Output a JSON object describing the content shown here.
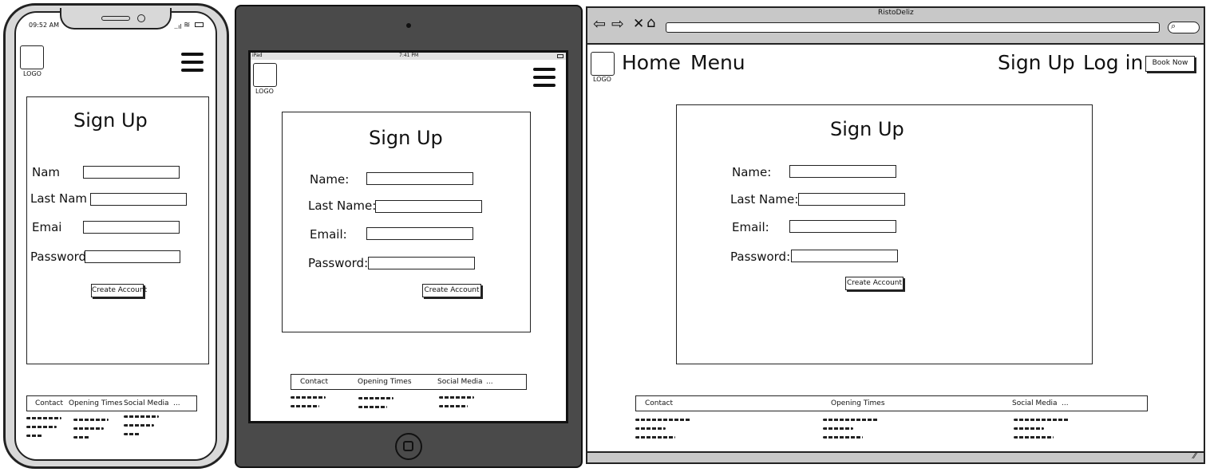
{
  "mobile": {
    "status_time": "09:52 AM",
    "logo_label": "LOGO",
    "title": "Sign Up",
    "labels": [
      "Nam",
      "Last Nam",
      "Emai",
      "Password"
    ],
    "button": "Create Account",
    "footer": [
      "Contact",
      "Opening Times",
      "Social Media",
      "..."
    ]
  },
  "tablet": {
    "status_device": "iPad",
    "status_time": "7:41 PM",
    "logo_label": "LOGO",
    "title": "Sign Up",
    "labels": [
      "Name:",
      "Last Name:",
      "Email:",
      "Password:"
    ],
    "button": "Create Account",
    "footer": [
      "Contact",
      "Opening Times",
      "Social Media",
      "..."
    ]
  },
  "desktop": {
    "window_title": "RistoDeliz",
    "logo_label": "LOGO",
    "nav": [
      "Home",
      "Menu",
      "Sign Up",
      "Log in"
    ],
    "book_button": "Book Now",
    "title": "Sign Up",
    "labels": [
      "Name:",
      "Last Name:",
      "Email:",
      "Password:"
    ],
    "button": "Create Account",
    "footer": [
      "Contact",
      "Opening Times",
      "Social Media",
      "..."
    ]
  },
  "icons": [
    "back-arrow-icon",
    "forward-arrow-icon",
    "close-icon",
    "home-icon",
    "search-icon",
    "hamburger-menu-icon",
    "wifi-icon",
    "battery-icon",
    "signal-icon",
    "home-button-icon",
    "camera-icon",
    "resize-grip-icon"
  ]
}
